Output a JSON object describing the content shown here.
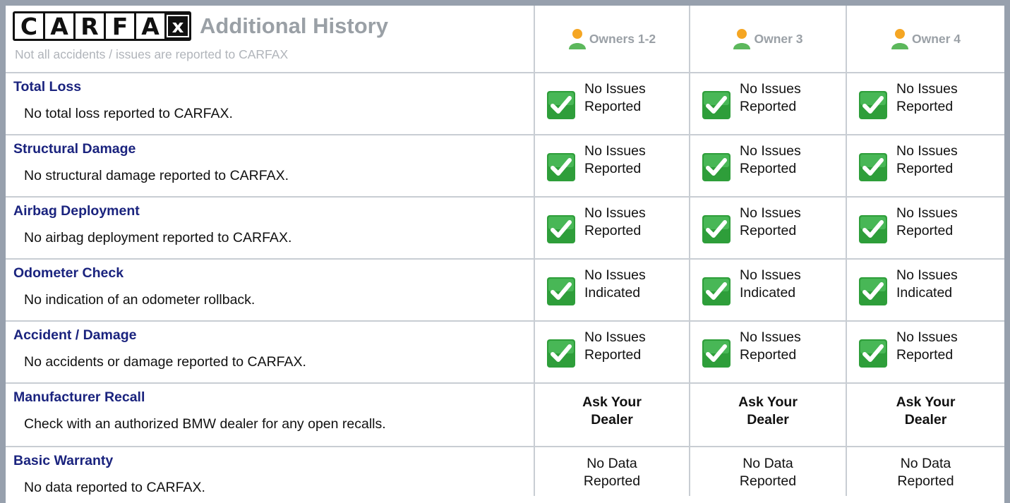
{
  "header": {
    "logo_letters": [
      "C",
      "A",
      "R",
      "F",
      "A",
      "x"
    ],
    "title": "Additional History",
    "subtitle": "Not all accidents / issues are reported to CARFAX",
    "owners": [
      "Owners 1-2",
      "Owner 3",
      "Owner 4"
    ]
  },
  "rows": [
    {
      "title": "Total Loss",
      "desc": "No total loss reported to CARFAX.",
      "status_type": "check",
      "status": [
        "No Issues",
        "Reported"
      ]
    },
    {
      "title": "Structural Damage",
      "desc": "No structural damage reported to CARFAX.",
      "status_type": "check",
      "status": [
        "No Issues",
        "Reported"
      ]
    },
    {
      "title": "Airbag Deployment",
      "desc": "No airbag deployment reported to CARFAX.",
      "status_type": "check",
      "status": [
        "No Issues",
        "Reported"
      ]
    },
    {
      "title": "Odometer Check",
      "desc": "No indication of an odometer rollback.",
      "status_type": "check",
      "status": [
        "No Issues",
        "Indicated"
      ]
    },
    {
      "title": "Accident / Damage",
      "desc": "No accidents or damage reported to CARFAX.",
      "status_type": "check",
      "status": [
        "No Issues",
        "Reported"
      ]
    },
    {
      "title": "Manufacturer Recall",
      "desc": "Check with an authorized BMW dealer for any open recalls.",
      "status_type": "bold",
      "status": [
        "Ask Your",
        "Dealer"
      ]
    },
    {
      "title": "Basic Warranty",
      "desc": "No data reported to CARFAX.",
      "status_type": "plain",
      "status": [
        "No Data",
        "Reported"
      ]
    }
  ],
  "colors": {
    "title_blue": "#1a237e",
    "check_green": "#2e9e3a",
    "header_gray": "#9aa0a6",
    "border": "#c8cdd3",
    "page_bg": "#97a0ad",
    "person_orange": "#f5a623",
    "person_green": "#5cb85c"
  },
  "icons": {
    "owner": "person-icon",
    "status": "checkmark-icon"
  }
}
